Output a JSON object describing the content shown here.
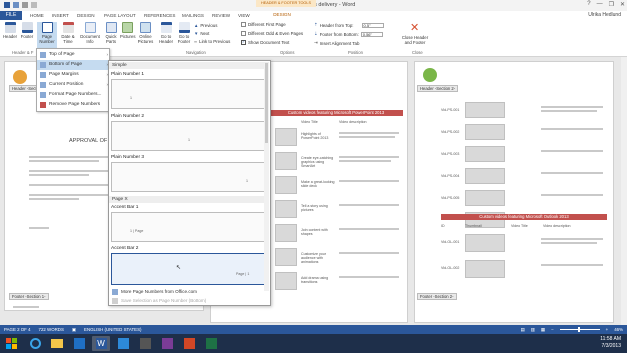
{
  "window": {
    "title": "Approval of videos delivery - Word",
    "controls": [
      "?",
      "—",
      "❐",
      "✕"
    ]
  },
  "tabs": {
    "file": "FILE",
    "items": [
      "HOME",
      "INSERT",
      "DESIGN",
      "PAGE LAYOUT",
      "REFERENCES",
      "MAILINGS",
      "REVIEW",
      "VIEW"
    ],
    "context_label": "HEADER & FOOTER TOOLS",
    "context_tab": "DESIGN",
    "user": "Ulrika Hedlund"
  },
  "ribbon": {
    "header": "Header",
    "footer": "Footer",
    "page_number": "Page Number",
    "date_time": "Date & Time",
    "document_info": "Document Info",
    "quick_parts": "Quick Parts",
    "pictures": "Pictures",
    "online_pictures": "Online Pictures",
    "go_to_header": "Go to Header",
    "go_to_footer": "Go to Footer",
    "previous": "Previous",
    "next": "Next",
    "link_to_previous": "Link to Previous",
    "different_first_page": "Different First Page",
    "different_odd_even": "Different Odd & Even Pages",
    "show_document_text": "Show Document Text",
    "header_from_top_label": "Header from Top:",
    "header_from_top_value": "0.5\"",
    "footer_from_bottom_label": "Footer from Bottom:",
    "footer_from_bottom_value": "0.56\"",
    "insert_alignment_tab": "Insert Alignment Tab",
    "close_header_footer": "Close Header and Footer",
    "groups": {
      "header_footer": "Header & F",
      "navigation": "Navigation",
      "options": "Options",
      "position": "Position",
      "close": "Close"
    }
  },
  "page_number_menu": {
    "items": [
      {
        "label": "Top of Page",
        "arrow": "›"
      },
      {
        "label": "Bottom of Page",
        "arrow": "›"
      },
      {
        "label": "Page Margins",
        "arrow": "›"
      },
      {
        "label": "Current Position",
        "arrow": "›"
      },
      {
        "label": "Format Page Numbers...",
        "arrow": ""
      },
      {
        "label": "Remove Page Numbers",
        "arrow": ""
      }
    ]
  },
  "gallery": {
    "section_simple": "Simple",
    "plain1": "Plain Number 1",
    "plain2": "Plain Number 2",
    "plain3": "Plain Number 3",
    "section_page_x": "Page X",
    "accent1": "Accent Bar 1",
    "accent2": "Accent Bar 2",
    "sample_num": "1",
    "accent_sample": "1 | Page",
    "accent_sample2": "Page | 1",
    "more_numbers": "More Page Numbers from Office.com",
    "save_selection": "Save Selection as Page Number (Bottom)"
  },
  "document": {
    "approval_heading": "APPROVAL OF",
    "header_section_left": "Header -Section 1-",
    "header_section_right": "Header -Section 2-",
    "footer_section_left": "Footer -Section 1-",
    "footer_section_mid": "Footer -Section 2-",
    "footer_section_right": "Footer -Section 2-",
    "table1_title": "Custom videos featuring Microsoft PowerPoint 2013",
    "table2_title": "Custom videos featuring Microsoft Outlook 2013",
    "col_headers": [
      "Video Title",
      "Video description"
    ],
    "col_headers_right": [
      "ID",
      "Thumbnail",
      "Video Title",
      "Video description"
    ],
    "mid_rows": [
      "Highlights of PowerPoint 2013",
      "Create eye-catching graphics using SmartArt",
      "Make a great-looking slide deck",
      "Tell a story using pictures",
      "Join content with shapes",
      "Customize your audience with animations",
      "Add drama using transitions"
    ],
    "right_ids": [
      "Vid-PS-001",
      "Vid-PS-002",
      "Vid-PS-003",
      "Vid-PS-004",
      "Vid-PS-005",
      "Vid-PS-006",
      "Vid-OL-001",
      "Vid-OL-002"
    ]
  },
  "statusbar": {
    "page": "PAGE 2 OF 4",
    "words": "722 WORDS",
    "language": "ENGLISH (UNITED STATES)",
    "zoom": "46%"
  },
  "taskbar": {
    "time": "11:58 AM",
    "date": "7/3/2013"
  },
  "colors": {
    "word_blue": "#2b579a",
    "accent_red": "#c2504d",
    "context_orange": "#b45c00"
  }
}
